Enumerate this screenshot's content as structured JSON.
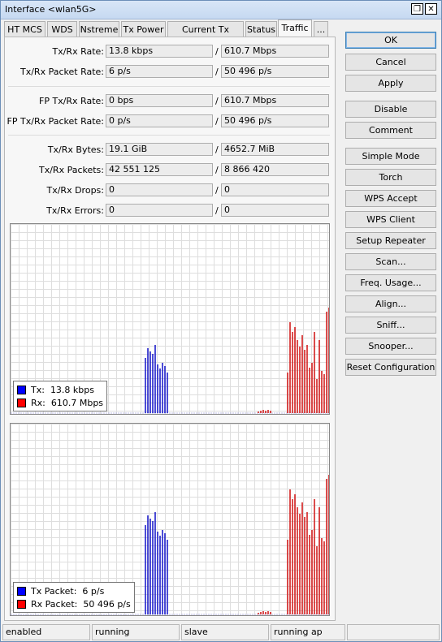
{
  "window": {
    "title": "Interface <wlan5G>",
    "restore_glyph": "❐",
    "close_glyph": "✕"
  },
  "tabs": [
    "HT MCS",
    "WDS",
    "Nstreme",
    "Tx Power",
    "Current Tx Power",
    "Status",
    "Traffic",
    "..."
  ],
  "active_tab": "Traffic",
  "fields": [
    {
      "label": "Tx/Rx Rate:",
      "tx": "13.8 kbps",
      "rx": "610.7 Mbps"
    },
    {
      "label": "Tx/Rx Packet Rate:",
      "tx": "6 p/s",
      "rx": "50 496 p/s"
    },
    {
      "label": "FP Tx/Rx Rate:",
      "tx": "0 bps",
      "rx": "610.7 Mbps"
    },
    {
      "label": "FP Tx/Rx Packet Rate:",
      "tx": "0 p/s",
      "rx": "50 496 p/s"
    },
    {
      "label": "Tx/Rx Bytes:",
      "tx": "19.1 GiB",
      "rx": "4652.7 MiB"
    },
    {
      "label": "Tx/Rx Packets:",
      "tx": "42 551 125",
      "rx": "8 866 420"
    },
    {
      "label": "Tx/Rx Drops:",
      "tx": "0",
      "rx": "0"
    },
    {
      "label": "Tx/Rx Errors:",
      "tx": "0",
      "rx": "0"
    }
  ],
  "separator": "/",
  "graphs": {
    "rate": {
      "tx_label": "Tx:",
      "tx_value": "13.8 kbps",
      "rx_label": "Rx:",
      "rx_value": "610.7 Mbps"
    },
    "packets": {
      "tx_label": "Tx Packet:",
      "tx_value": "6 p/s",
      "rx_label": "Rx Packet:",
      "rx_value": "50 496 p/s"
    }
  },
  "colors": {
    "tx": "#0000ff",
    "rx": "#ff0000",
    "tx_line": "#1010c8",
    "rx_line": "#d01010"
  },
  "buttons": [
    "OK",
    "Cancel",
    "Apply",
    "Disable",
    "Comment",
    "Simple Mode",
    "Torch",
    "WPS Accept",
    "WPS Client",
    "Setup Repeater",
    "Scan...",
    "Freq. Usage...",
    "Align...",
    "Sniff...",
    "Snooper...",
    "Reset Configuration"
  ],
  "statusbar": [
    "enabled",
    "running",
    "slave",
    "running ap",
    ""
  ]
}
